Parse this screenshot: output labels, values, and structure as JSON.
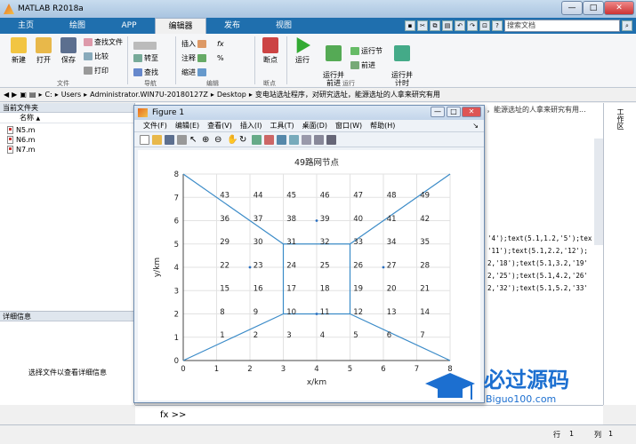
{
  "window": {
    "title": "MATLAB R2018a",
    "min": "—",
    "max": "□",
    "close": "✕"
  },
  "tabs": [
    "主页",
    "绘图",
    "APP",
    "编辑器",
    "发布",
    "视图"
  ],
  "active_tab": "编辑器",
  "search": {
    "placeholder": "搜索文档"
  },
  "ribbon": {
    "new": "新建",
    "open": "打开",
    "save": "保存",
    "find_files": "查找文件",
    "compare": "比较",
    "print": "打印",
    "goto": "转至",
    "find": "查找",
    "insert": "插入",
    "fx": "fx",
    "comment": "注释",
    "percent": "%",
    "indent": "缩进",
    "breakpoints": "断点",
    "run": "运行",
    "run_advance": "运行并\n前进",
    "run_section": "运行节",
    "advance": "前进",
    "run_time": "运行并\n计时",
    "groups": {
      "file": "文件",
      "nav": "导航",
      "edit": "编辑",
      "bp": "断点",
      "run": "运行"
    }
  },
  "address": {
    "path": [
      "C:",
      "Users",
      "Administrator.WIN7U-20180127Z",
      "Desktop",
      "变电站选址程序，对研究选址，能源选址的人拿来研究有用"
    ]
  },
  "current_folder": {
    "header": "当前文件夹",
    "col_name": "名称",
    "sort": "▲",
    "files": [
      "N5.m",
      "N6.m",
      "N7.m"
    ]
  },
  "details": {
    "header": "详细信息",
    "hint": "选择文件以查看详细信息"
  },
  "right_panel": {
    "label": "工作区"
  },
  "editor_code": {
    "lines": [
      "'4');text(5.1,1.2,'5');tex",
      "'11');text(5.1,2.2,'12');",
      "2,'18');text(5.1,3.2,'19'",
      "2,'25');text(5.1,4.2,'26'",
      "2,'32');text(5.1,5.2,'33'"
    ],
    "top_snip": "，能源选址的人拿来研究有用..."
  },
  "figure": {
    "title": "Figure 1",
    "menu": [
      "文件(F)",
      "编辑(E)",
      "查看(V)",
      "插入(I)",
      "工具(T)",
      "桌面(D)",
      "窗口(W)",
      "帮助(H)"
    ],
    "dock": "↘"
  },
  "command": {
    "prompt": "fx >>"
  },
  "status": {
    "row_label": "行",
    "row": "1",
    "col_label": "列",
    "col": "1"
  },
  "watermark": {
    "text": "必过源码",
    "url": "Biguo100.com"
  },
  "chart_data": {
    "type": "scatter",
    "title": "49路网节点",
    "xlabel": "x/km",
    "ylabel": "y/km",
    "xlim": [
      0,
      8
    ],
    "ylim": [
      0,
      8
    ],
    "xticks": [
      0,
      1,
      2,
      3,
      4,
      5,
      6,
      7,
      8
    ],
    "yticks": [
      0,
      1,
      2,
      3,
      4,
      5,
      6,
      7,
      8
    ],
    "grid": true,
    "node_labels": [
      {
        "t": "1",
        "x": 1.1,
        "y": 1.1
      },
      {
        "t": "2",
        "x": 2.1,
        "y": 1.1
      },
      {
        "t": "3",
        "x": 3.1,
        "y": 1.1
      },
      {
        "t": "4",
        "x": 4.1,
        "y": 1.1
      },
      {
        "t": "5",
        "x": 5.1,
        "y": 1.1
      },
      {
        "t": "6",
        "x": 6.1,
        "y": 1.1
      },
      {
        "t": "7",
        "x": 7.1,
        "y": 1.1
      },
      {
        "t": "8",
        "x": 1.1,
        "y": 2.1
      },
      {
        "t": "9",
        "x": 2.1,
        "y": 2.1
      },
      {
        "t": "10",
        "x": 3.1,
        "y": 2.1
      },
      {
        "t": "11",
        "x": 4.1,
        "y": 2.1
      },
      {
        "t": "12",
        "x": 5.1,
        "y": 2.1
      },
      {
        "t": "13",
        "x": 6.1,
        "y": 2.1
      },
      {
        "t": "14",
        "x": 7.1,
        "y": 2.1
      },
      {
        "t": "15",
        "x": 1.1,
        "y": 3.1
      },
      {
        "t": "16",
        "x": 2.1,
        "y": 3.1
      },
      {
        "t": "17",
        "x": 3.1,
        "y": 3.1
      },
      {
        "t": "18",
        "x": 4.1,
        "y": 3.1
      },
      {
        "t": "19",
        "x": 5.1,
        "y": 3.1
      },
      {
        "t": "20",
        "x": 6.1,
        "y": 3.1
      },
      {
        "t": "21",
        "x": 7.1,
        "y": 3.1
      },
      {
        "t": "22",
        "x": 1.1,
        "y": 4.1
      },
      {
        "t": "23",
        "x": 2.1,
        "y": 4.1
      },
      {
        "t": "24",
        "x": 3.1,
        "y": 4.1
      },
      {
        "t": "25",
        "x": 4.1,
        "y": 4.1
      },
      {
        "t": "26",
        "x": 5.1,
        "y": 4.1
      },
      {
        "t": "27",
        "x": 6.1,
        "y": 4.1
      },
      {
        "t": "28",
        "x": 7.1,
        "y": 4.1
      },
      {
        "t": "29",
        "x": 1.1,
        "y": 5.1
      },
      {
        "t": "30",
        "x": 2.1,
        "y": 5.1
      },
      {
        "t": "31",
        "x": 3.1,
        "y": 5.1
      },
      {
        "t": "32",
        "x": 4.1,
        "y": 5.1
      },
      {
        "t": "33",
        "x": 5.1,
        "y": 5.1
      },
      {
        "t": "34",
        "x": 6.1,
        "y": 5.1
      },
      {
        "t": "35",
        "x": 7.1,
        "y": 5.1
      },
      {
        "t": "36",
        "x": 1.1,
        "y": 6.1
      },
      {
        "t": "37",
        "x": 2.1,
        "y": 6.1
      },
      {
        "t": "38",
        "x": 3.1,
        "y": 6.1
      },
      {
        "t": "39",
        "x": 4.1,
        "y": 6.1
      },
      {
        "t": "40",
        "x": 5.1,
        "y": 6.1
      },
      {
        "t": "41",
        "x": 6.1,
        "y": 6.1
      },
      {
        "t": "42",
        "x": 7.1,
        "y": 6.1
      },
      {
        "t": "43",
        "x": 1.1,
        "y": 7.1
      },
      {
        "t": "44",
        "x": 2.1,
        "y": 7.1
      },
      {
        "t": "45",
        "x": 3.1,
        "y": 7.1
      },
      {
        "t": "46",
        "x": 4.1,
        "y": 7.1
      },
      {
        "t": "47",
        "x": 5.1,
        "y": 7.1
      },
      {
        "t": "48",
        "x": 6.1,
        "y": 7.1
      },
      {
        "t": "49",
        "x": 7.1,
        "y": 7.1
      }
    ],
    "lines": [
      [
        [
          0,
          0
        ],
        [
          3,
          2
        ]
      ],
      [
        [
          0,
          8
        ],
        [
          3,
          5
        ]
      ],
      [
        [
          8,
          8
        ],
        [
          5,
          5
        ]
      ],
      [
        [
          8,
          0
        ],
        [
          5,
          2
        ]
      ],
      [
        [
          3,
          2
        ],
        [
          5,
          2
        ]
      ],
      [
        [
          5,
          2
        ],
        [
          5,
          5
        ]
      ],
      [
        [
          5,
          5
        ],
        [
          3,
          5
        ]
      ],
      [
        [
          3,
          5
        ],
        [
          3,
          2
        ]
      ]
    ],
    "points": [
      [
        2,
        4
      ],
      [
        4,
        6
      ],
      [
        6,
        4
      ],
      [
        4,
        2
      ]
    ]
  }
}
